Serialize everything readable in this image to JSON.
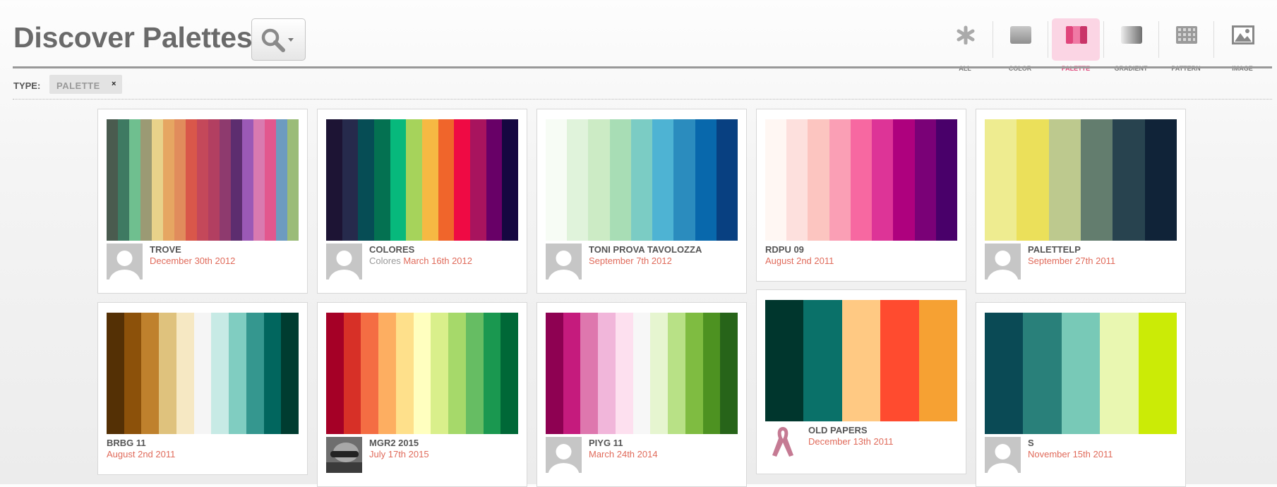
{
  "header": {
    "title": "Discover Palettes"
  },
  "search": {
    "icon": "magnifier-dropdown-icon"
  },
  "filters": [
    {
      "label": "ALL",
      "icon": "asterisk-icon",
      "active": false
    },
    {
      "label": "COLOR",
      "icon": "color-swatch-icon",
      "active": false
    },
    {
      "label": "PALETTE",
      "icon": "palette-icon",
      "active": true
    },
    {
      "label": "GRADIENT",
      "icon": "gradient-icon",
      "active": false
    },
    {
      "label": "PATTERN",
      "icon": "pattern-icon",
      "active": false
    },
    {
      "label": "IMAGE",
      "icon": "image-icon",
      "active": false
    }
  ],
  "type_filter": {
    "label": "TYPE:",
    "value": "PALETTE",
    "remove": "×"
  },
  "palettes": [
    {
      "name": "TROVE",
      "author": "",
      "date": "December 30th 2012",
      "colors": [
        "#4a5b4f",
        "#3e7a62",
        "#6fbf8f",
        "#9b9a74",
        "#e8d28a",
        "#e6a662",
        "#e18c5c",
        "#d9574a",
        "#c4485a",
        "#b23f61",
        "#8e3a6e",
        "#5d2d6f",
        "#9b59b6",
        "#d97ab0",
        "#e2578e",
        "#6d9bc0",
        "#9bbc78"
      ]
    },
    {
      "name": "COLORES",
      "author": "Colores",
      "date": "March 16th 2012",
      "colors": [
        "#1d1434",
        "#262a4c",
        "#064d55",
        "#047151",
        "#07b97c",
        "#a6d35b",
        "#f6b943",
        "#f0652b",
        "#ef0a44",
        "#a8145e",
        "#680067",
        "#150741"
      ]
    },
    {
      "name": "TONI PROVA TAVOLOZZA",
      "author": "",
      "date": "September 7th 2012",
      "colors": [
        "#f7fcf5",
        "#e0f3db",
        "#ccebc5",
        "#a8ddb5",
        "#7bccc4",
        "#4eb3d3",
        "#2b8cbe",
        "#0868ac",
        "#084081"
      ]
    },
    {
      "name": "RDPU 09",
      "author": "",
      "date": "August 2nd 2011",
      "colors": [
        "#fff7f3",
        "#fde0dd",
        "#fcc5c0",
        "#fa9fb5",
        "#f768a1",
        "#dd3497",
        "#ae017e",
        "#7a0177",
        "#49006a"
      ]
    },
    {
      "name": "PALETTELP",
      "author": "",
      "date": "September 27th 2011",
      "colors": [
        "#eeec90",
        "#ebe05a",
        "#bdc98e",
        "#637d6e",
        "#28434f",
        "#102338"
      ]
    },
    {
      "name": "BRBG 11",
      "author": "",
      "date": "August 2nd 2011",
      "colors": [
        "#543005",
        "#8c510a",
        "#bf812d",
        "#dfc27d",
        "#f6e8c3",
        "#f5f5f5",
        "#c7eae5",
        "#80cdc1",
        "#35978f",
        "#01665e",
        "#003c30"
      ]
    },
    {
      "name": "MGR2 2015",
      "author": "",
      "date": "July 17th 2015",
      "colors": [
        "#a50026",
        "#d73027",
        "#f46d43",
        "#fdae61",
        "#fee08b",
        "#ffffbf",
        "#d9ef8b",
        "#a6d96a",
        "#66bd63",
        "#1a9850",
        "#006837"
      ]
    },
    {
      "name": "PIYG 11",
      "author": "",
      "date": "March 24th 2014",
      "colors": [
        "#8e0152",
        "#c51b7d",
        "#de77ae",
        "#f1b6da",
        "#fde0ef",
        "#f7f7f7",
        "#e6f5d0",
        "#b8e186",
        "#7fbc41",
        "#4d9221",
        "#276419"
      ]
    },
    {
      "name": "OLD PAPERS",
      "author": "",
      "date": "December 13th 2011",
      "colors": [
        "#00362d",
        "#0a7169",
        "#ffc983",
        "#ff4b2f",
        "#f6a133"
      ]
    },
    {
      "name": "S",
      "author": "",
      "date": "November 15th 2011",
      "colors": [
        "#0a4a55",
        "#29807a",
        "#78c9b7",
        "#e9f7b1",
        "#cbeb06"
      ]
    }
  ]
}
